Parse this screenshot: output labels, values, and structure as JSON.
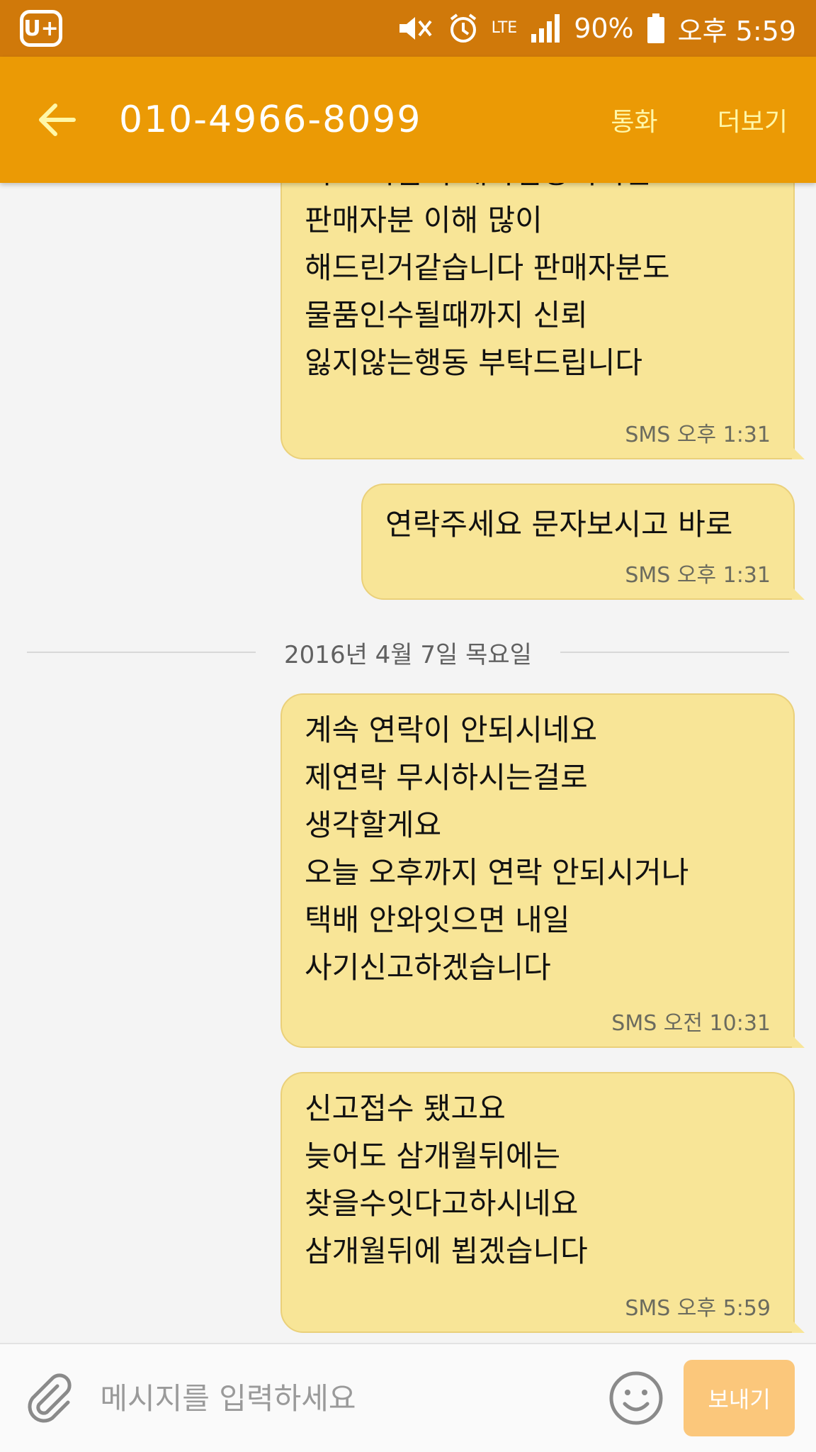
{
  "status_bar": {
    "carrier_logo": "U+",
    "icons": [
      "mute-icon",
      "alarm-icon",
      "lte-icon",
      "signal-icon"
    ],
    "lte_label": "LTE",
    "battery": "90%",
    "time": "오후 5:59"
  },
  "header": {
    "back_icon": "back-arrow-icon",
    "title": "010-4966-8099",
    "call_label": "통화",
    "more_label": "더보기"
  },
  "messages_before": [
    {
      "lines": [
        "저도 나름 구매자입장이지만",
        "판매자분 이해 많이",
        "해드린거같습니다 판매자분도",
        "물품인수될때까지 신뢰",
        "잃지않는행동 부탁드립니다"
      ],
      "meta": "SMS 오후 1:31"
    },
    {
      "lines": [
        "연락주세요 문자보시고 바로"
      ],
      "meta": "SMS 오후 1:31"
    }
  ],
  "date_divider": "2016년 4월 7일 목요일",
  "messages_after": [
    {
      "lines": [
        "계속 연락이 안되시네요",
        "제연락 무시하시는걸로",
        "생각할게요",
        "오늘 오후까지 연락 안되시거나",
        "택배 안와잇으면 내일",
        "사기신고하겠습니다"
      ],
      "meta": "SMS 오전 10:31"
    },
    {
      "lines": [
        "신고접수 됐고요",
        "늦어도 삼개월뒤에는",
        "찾을수잇다고하시네요",
        "삼개월뒤에 뵙겠습니다"
      ],
      "meta": "SMS 오후 5:59"
    }
  ],
  "composer": {
    "attach_icon": "paperclip-icon",
    "placeholder": "메시지를 입력하세요",
    "value": "",
    "emoji_icon": "smiley-icon",
    "send_label": "보내기"
  },
  "colors": {
    "status_bar": "#d0790a",
    "app_bar": "#eb9a05",
    "bubble": "#f8e597",
    "send_button": "#fbc77b"
  }
}
